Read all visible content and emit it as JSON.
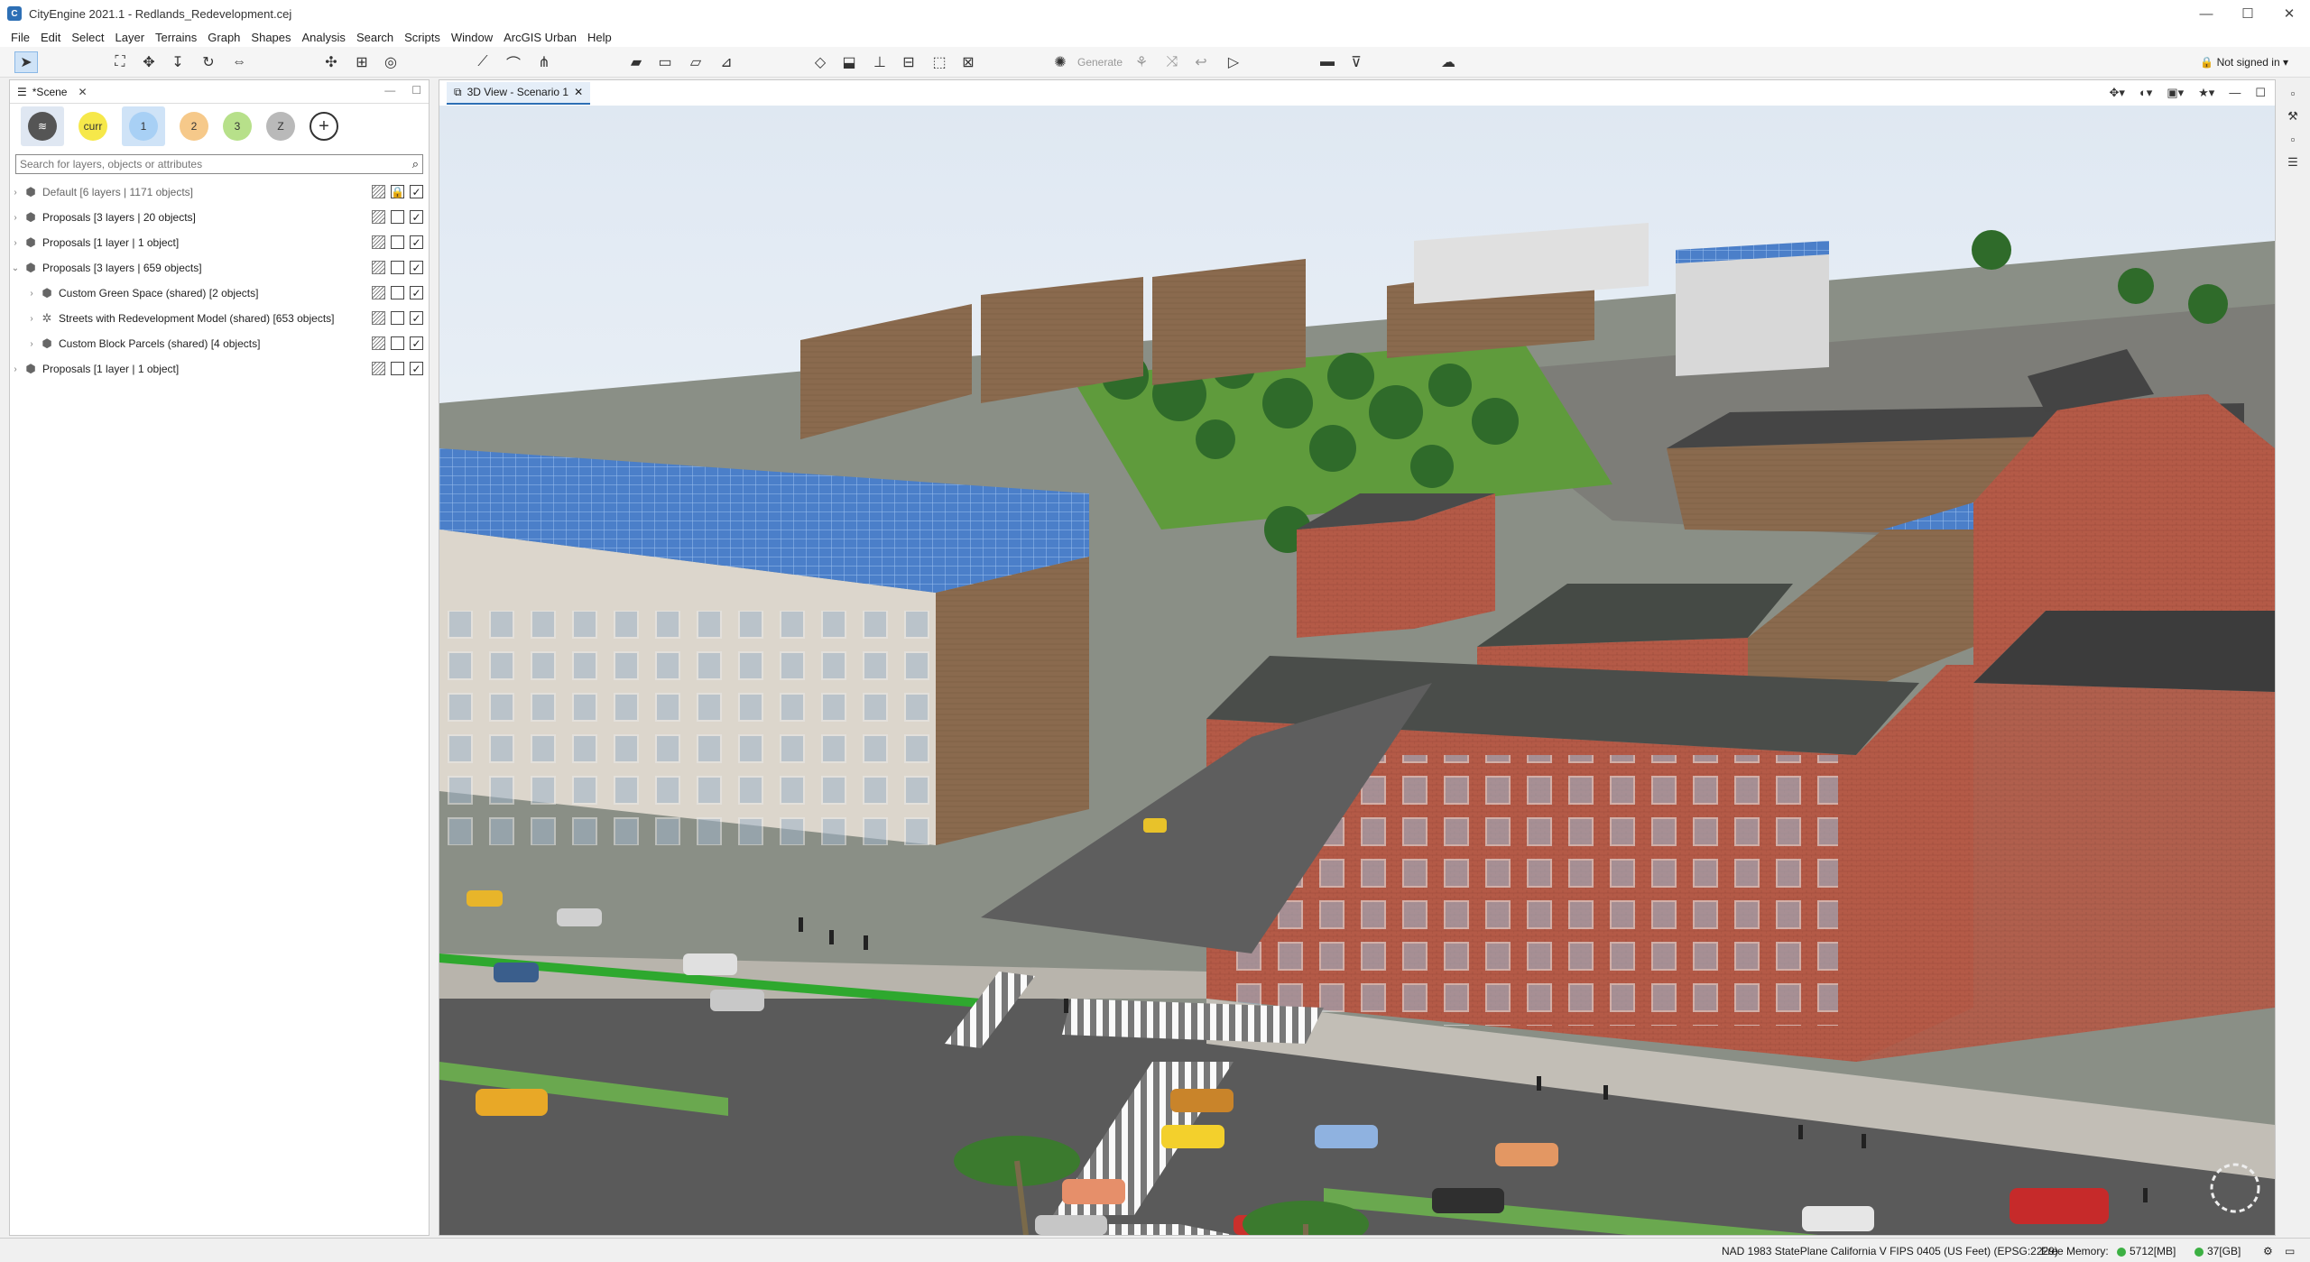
{
  "window": {
    "title": "CityEngine 2021.1 - Redlands_Redevelopment.cej",
    "controls": [
      "—",
      "☐",
      "✕"
    ]
  },
  "menu": [
    "File",
    "Edit",
    "Select",
    "Layer",
    "Terrains",
    "Graph",
    "Shapes",
    "Analysis",
    "Search",
    "Scripts",
    "Window",
    "ArcGIS Urban",
    "Help"
  ],
  "toolbar": {
    "generate_label": "Generate",
    "signin_label": "Not signed in"
  },
  "scene_panel": {
    "tab_label": "*Scene",
    "scenarios": [
      "curr",
      "1",
      "2",
      "3",
      "Z"
    ],
    "search_placeholder": "Search for layers, objects or attributes",
    "layers": [
      {
        "label": "Default [6 layers | 1171 objects]",
        "level": 0,
        "expanded": false,
        "locked": true,
        "visible": true,
        "dim": true
      },
      {
        "label": "Proposals [3 layers | 20 objects]",
        "level": 0,
        "expanded": false,
        "locked": false,
        "visible": true,
        "dim": false
      },
      {
        "label": "Proposals [1 layer | 1 object]",
        "level": 0,
        "expanded": false,
        "locked": false,
        "visible": true,
        "dim": false
      },
      {
        "label": "Proposals [3 layers | 659 objects]",
        "level": 0,
        "expanded": true,
        "locked": false,
        "visible": true,
        "dim": false
      },
      {
        "label": "Custom Green Space (shared) [2 objects]",
        "level": 1,
        "expanded": false,
        "locked": false,
        "visible": true,
        "dim": false
      },
      {
        "label": "Streets with Redevelopment Model (shared) [653 objects]",
        "level": 1,
        "expanded": false,
        "locked": false,
        "visible": true,
        "dim": false
      },
      {
        "label": "Custom Block Parcels (shared) [4 objects]",
        "level": 1,
        "expanded": false,
        "locked": false,
        "visible": true,
        "dim": false
      },
      {
        "label": "Proposals [1 layer | 1 object]",
        "level": 0,
        "expanded": false,
        "locked": false,
        "visible": true,
        "dim": false
      }
    ]
  },
  "view": {
    "tab_label": "3D View - Scenario 1"
  },
  "status": {
    "crs": "NAD 1983 StatePlane California V FIPS 0405 (US Feet) (EPSG:2229)",
    "free_memory_label": "Free Memory:",
    "mem1": "5712[MB]",
    "mem2": "37[GB]"
  },
  "colors": {
    "accent": "#2d6fb5",
    "scenario_curr": "#f6e84a",
    "scenario_1": "#cfe3f7",
    "scenario_2": "#f6c98a",
    "scenario_3": "#b7e08a",
    "scenario_z": "#b9b9b9"
  }
}
